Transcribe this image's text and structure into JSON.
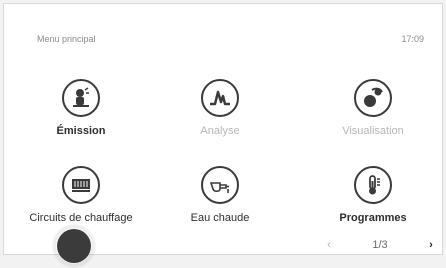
{
  "header": {
    "title": "Menu principal",
    "time": "17:09"
  },
  "tiles": [
    {
      "id": "emission",
      "label": "Émission",
      "icon": "emission-icon",
      "enabled": true
    },
    {
      "id": "analyse",
      "label": "Analyse",
      "icon": "analyse-icon",
      "enabled": false
    },
    {
      "id": "visualisation",
      "label": "Visualisation",
      "icon": "visualisation-icon",
      "enabled": false
    },
    {
      "id": "circuits",
      "label": "Circuits de chauffage",
      "icon": "heating-circuit-icon",
      "enabled": true
    },
    {
      "id": "eau",
      "label": "Eau chaude",
      "icon": "hot-water-icon",
      "enabled": true
    },
    {
      "id": "programmes",
      "label": "Programmes",
      "icon": "thermometer-icon",
      "enabled": true
    }
  ],
  "pager": {
    "text": "1/3"
  }
}
